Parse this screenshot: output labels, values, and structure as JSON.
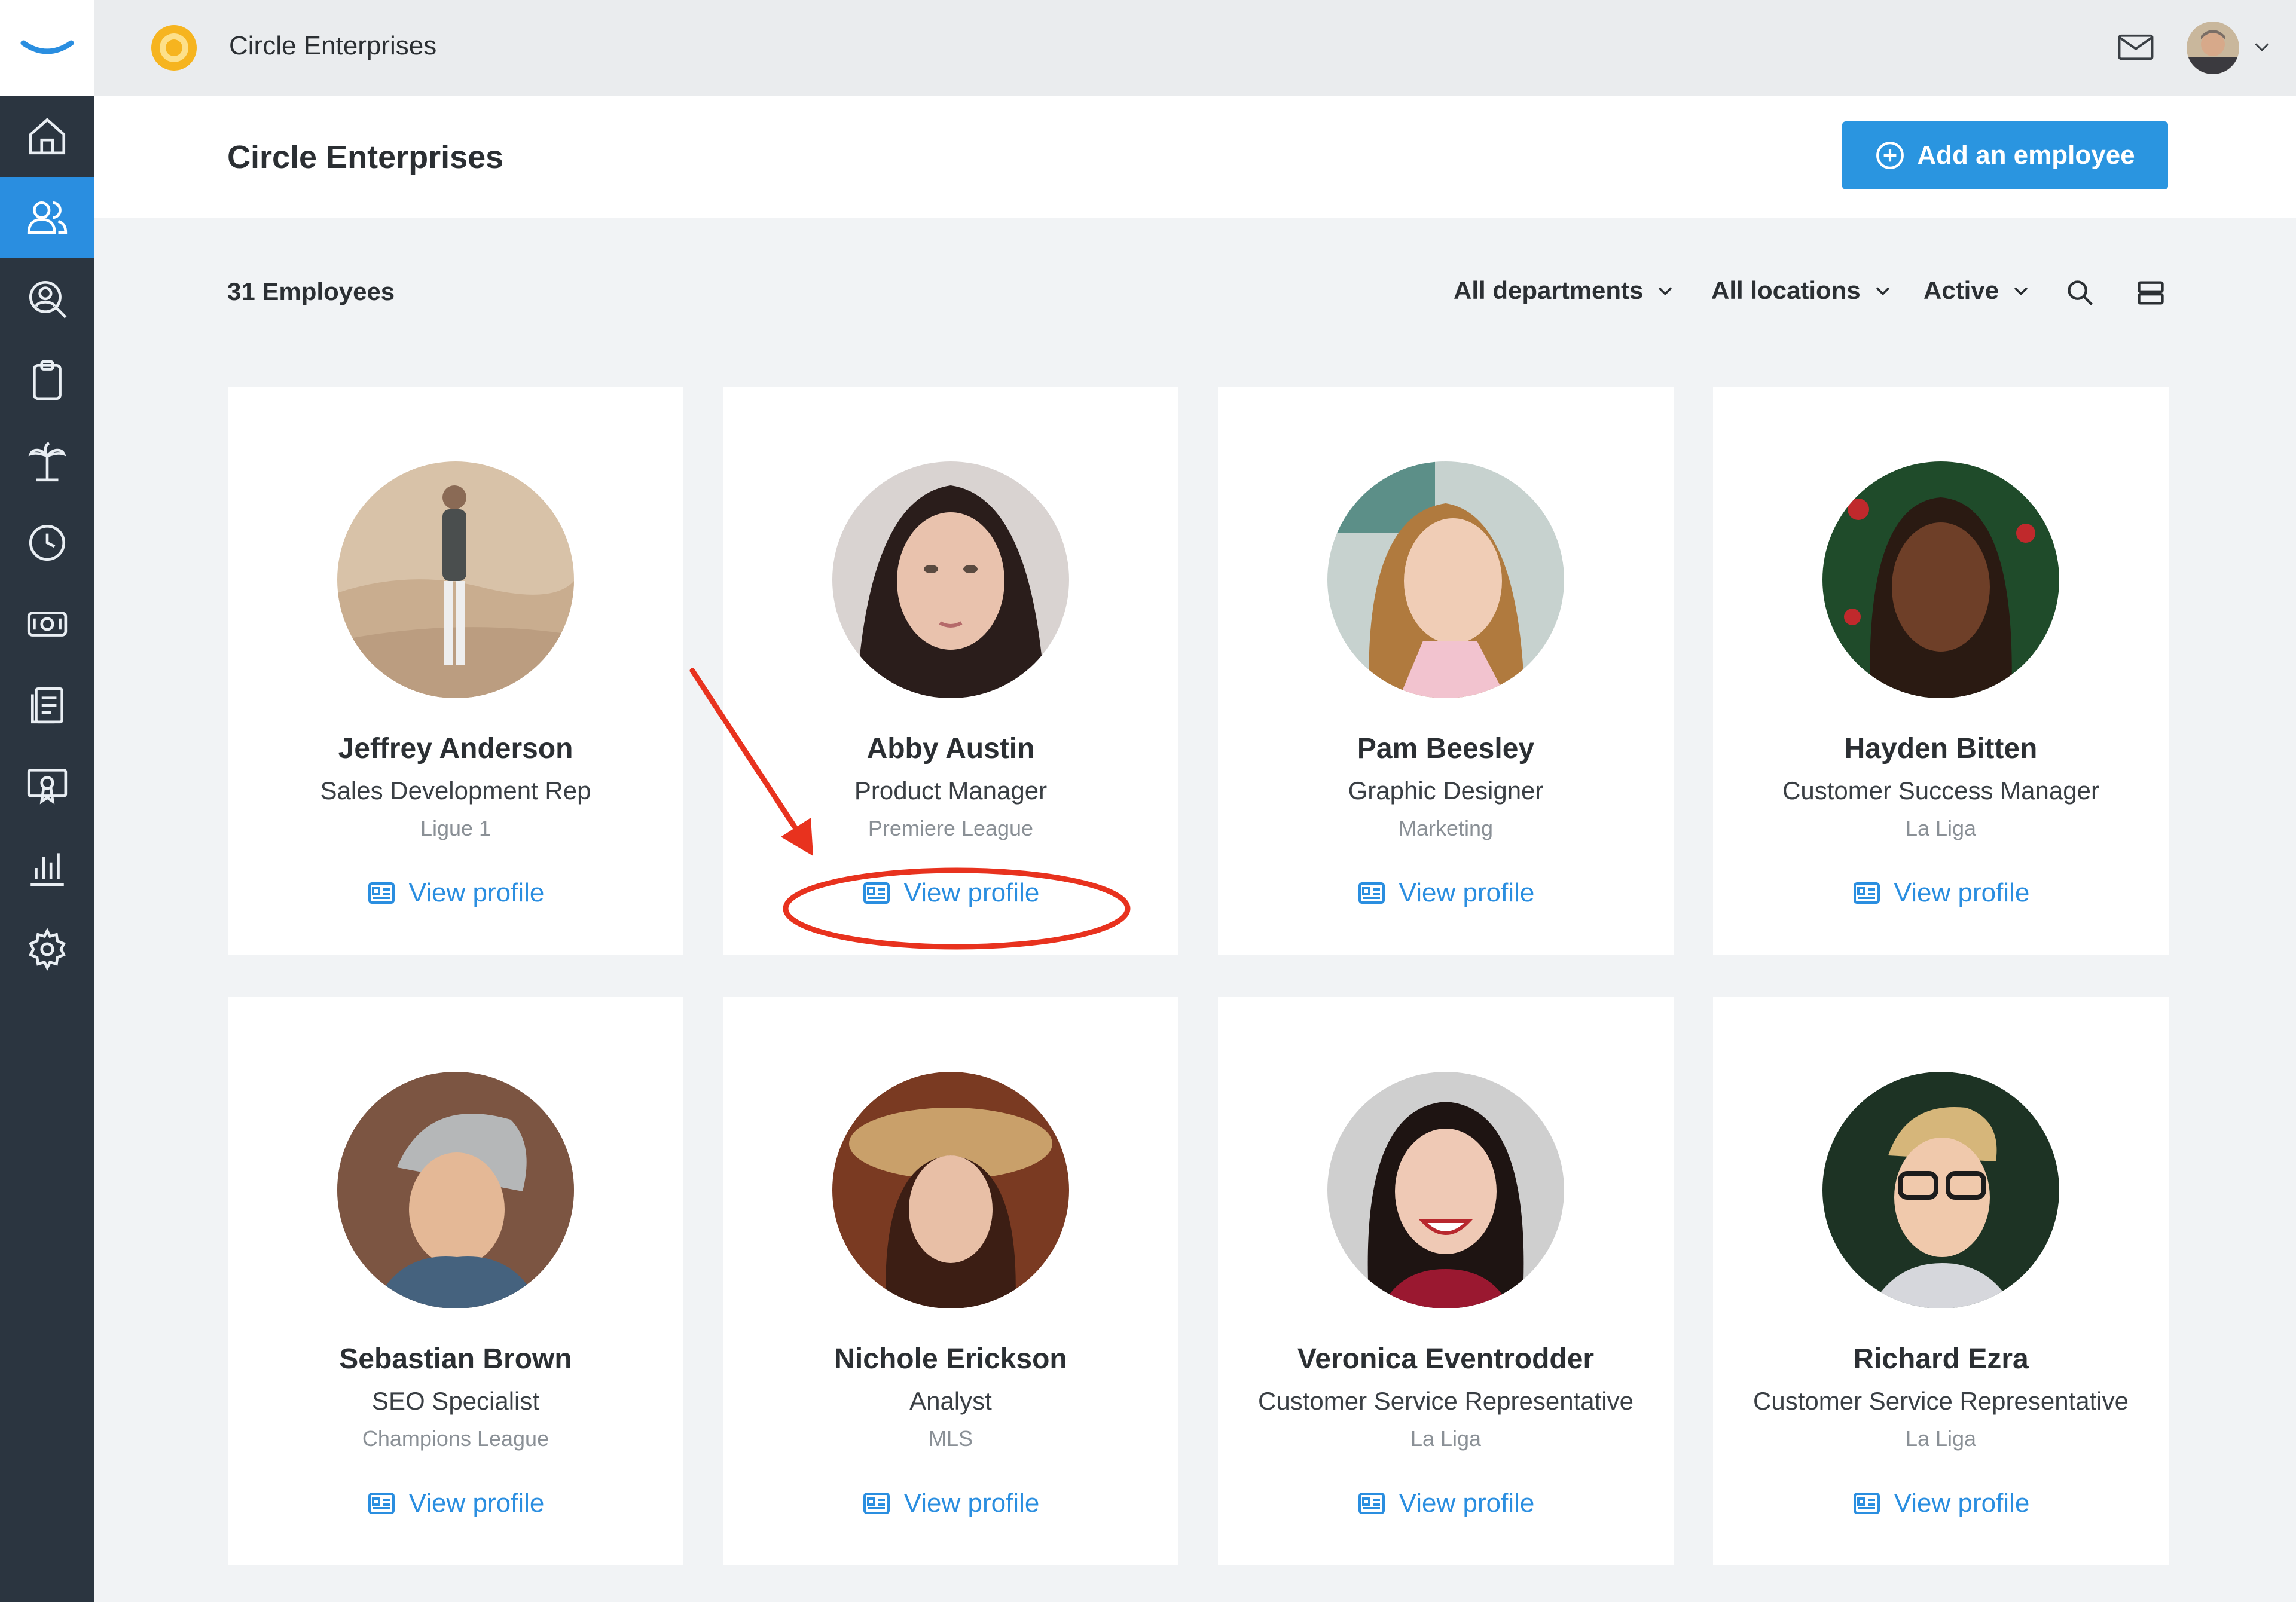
{
  "topbar": {
    "company_name": "Circle Enterprises"
  },
  "sidebar": {
    "items": [
      {
        "icon": "home-icon"
      },
      {
        "icon": "people-icon",
        "active": true
      },
      {
        "icon": "people-search-icon"
      },
      {
        "icon": "clipboard-icon"
      },
      {
        "icon": "palm-tree-icon"
      },
      {
        "icon": "clock-icon"
      },
      {
        "icon": "money-icon"
      },
      {
        "icon": "documents-icon"
      },
      {
        "icon": "certificate-icon"
      },
      {
        "icon": "bar-chart-icon"
      },
      {
        "icon": "gear-icon"
      }
    ]
  },
  "header": {
    "title": "Circle Enterprises",
    "add_button_label": "Add an employee"
  },
  "filters": {
    "count_label": "31 Employees",
    "departments": "All departments",
    "locations": "All locations",
    "status": "Active"
  },
  "employees": [
    {
      "name": "Jeffrey Anderson",
      "role": "Sales Development Rep",
      "dept": "Ligue 1",
      "link": "View profile"
    },
    {
      "name": "Abby Austin",
      "role": "Product Manager",
      "dept": "Premiere League",
      "link": "View profile"
    },
    {
      "name": "Pam Beesley",
      "role": "Graphic Designer",
      "dept": "Marketing",
      "link": "View profile"
    },
    {
      "name": "Hayden Bitten",
      "role": "Customer Success Manager",
      "dept": "La Liga",
      "link": "View profile"
    },
    {
      "name": "Sebastian Brown",
      "role": "SEO Specialist",
      "dept": "Champions League",
      "link": "View profile"
    },
    {
      "name": "Nichole Erickson",
      "role": "Analyst",
      "dept": "MLS",
      "link": "View profile"
    },
    {
      "name": "Veronica Eventrodder",
      "role": "Customer Service Representative",
      "dept": "La Liga",
      "link": "View profile"
    },
    {
      "name": "Richard Ezra",
      "role": "Customer Service Representative",
      "dept": "La Liga",
      "link": "View profile"
    }
  ],
  "colors": {
    "accent": "#2a8ee0",
    "sidebar": "#2b3540",
    "annotation": "#e8321e"
  }
}
